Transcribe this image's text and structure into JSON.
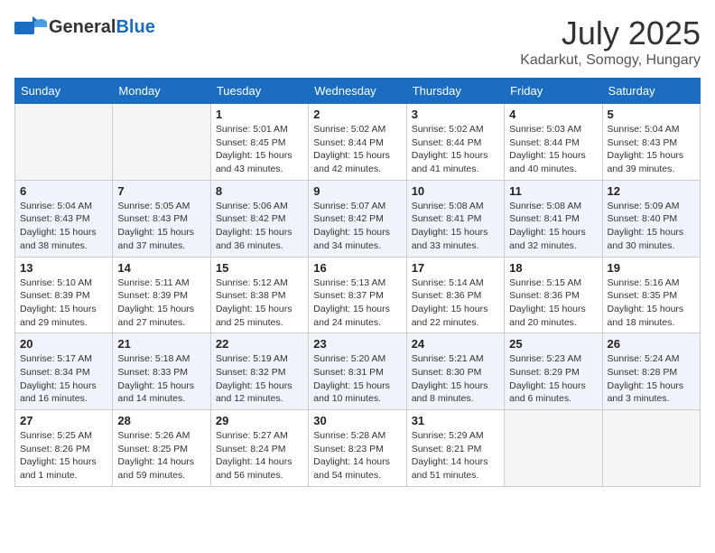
{
  "header": {
    "logo_general": "General",
    "logo_blue": "Blue",
    "month": "July 2025",
    "location": "Kadarkut, Somogy, Hungary"
  },
  "days_of_week": [
    "Sunday",
    "Monday",
    "Tuesday",
    "Wednesday",
    "Thursday",
    "Friday",
    "Saturday"
  ],
  "weeks": [
    [
      {
        "day": "",
        "info": ""
      },
      {
        "day": "",
        "info": ""
      },
      {
        "day": "1",
        "info": "Sunrise: 5:01 AM\nSunset: 8:45 PM\nDaylight: 15 hours and 43 minutes."
      },
      {
        "day": "2",
        "info": "Sunrise: 5:02 AM\nSunset: 8:44 PM\nDaylight: 15 hours and 42 minutes."
      },
      {
        "day": "3",
        "info": "Sunrise: 5:02 AM\nSunset: 8:44 PM\nDaylight: 15 hours and 41 minutes."
      },
      {
        "day": "4",
        "info": "Sunrise: 5:03 AM\nSunset: 8:44 PM\nDaylight: 15 hours and 40 minutes."
      },
      {
        "day": "5",
        "info": "Sunrise: 5:04 AM\nSunset: 8:43 PM\nDaylight: 15 hours and 39 minutes."
      }
    ],
    [
      {
        "day": "6",
        "info": "Sunrise: 5:04 AM\nSunset: 8:43 PM\nDaylight: 15 hours and 38 minutes."
      },
      {
        "day": "7",
        "info": "Sunrise: 5:05 AM\nSunset: 8:43 PM\nDaylight: 15 hours and 37 minutes."
      },
      {
        "day": "8",
        "info": "Sunrise: 5:06 AM\nSunset: 8:42 PM\nDaylight: 15 hours and 36 minutes."
      },
      {
        "day": "9",
        "info": "Sunrise: 5:07 AM\nSunset: 8:42 PM\nDaylight: 15 hours and 34 minutes."
      },
      {
        "day": "10",
        "info": "Sunrise: 5:08 AM\nSunset: 8:41 PM\nDaylight: 15 hours and 33 minutes."
      },
      {
        "day": "11",
        "info": "Sunrise: 5:08 AM\nSunset: 8:41 PM\nDaylight: 15 hours and 32 minutes."
      },
      {
        "day": "12",
        "info": "Sunrise: 5:09 AM\nSunset: 8:40 PM\nDaylight: 15 hours and 30 minutes."
      }
    ],
    [
      {
        "day": "13",
        "info": "Sunrise: 5:10 AM\nSunset: 8:39 PM\nDaylight: 15 hours and 29 minutes."
      },
      {
        "day": "14",
        "info": "Sunrise: 5:11 AM\nSunset: 8:39 PM\nDaylight: 15 hours and 27 minutes."
      },
      {
        "day": "15",
        "info": "Sunrise: 5:12 AM\nSunset: 8:38 PM\nDaylight: 15 hours and 25 minutes."
      },
      {
        "day": "16",
        "info": "Sunrise: 5:13 AM\nSunset: 8:37 PM\nDaylight: 15 hours and 24 minutes."
      },
      {
        "day": "17",
        "info": "Sunrise: 5:14 AM\nSunset: 8:36 PM\nDaylight: 15 hours and 22 minutes."
      },
      {
        "day": "18",
        "info": "Sunrise: 5:15 AM\nSunset: 8:36 PM\nDaylight: 15 hours and 20 minutes."
      },
      {
        "day": "19",
        "info": "Sunrise: 5:16 AM\nSunset: 8:35 PM\nDaylight: 15 hours and 18 minutes."
      }
    ],
    [
      {
        "day": "20",
        "info": "Sunrise: 5:17 AM\nSunset: 8:34 PM\nDaylight: 15 hours and 16 minutes."
      },
      {
        "day": "21",
        "info": "Sunrise: 5:18 AM\nSunset: 8:33 PM\nDaylight: 15 hours and 14 minutes."
      },
      {
        "day": "22",
        "info": "Sunrise: 5:19 AM\nSunset: 8:32 PM\nDaylight: 15 hours and 12 minutes."
      },
      {
        "day": "23",
        "info": "Sunrise: 5:20 AM\nSunset: 8:31 PM\nDaylight: 15 hours and 10 minutes."
      },
      {
        "day": "24",
        "info": "Sunrise: 5:21 AM\nSunset: 8:30 PM\nDaylight: 15 hours and 8 minutes."
      },
      {
        "day": "25",
        "info": "Sunrise: 5:23 AM\nSunset: 8:29 PM\nDaylight: 15 hours and 6 minutes."
      },
      {
        "day": "26",
        "info": "Sunrise: 5:24 AM\nSunset: 8:28 PM\nDaylight: 15 hours and 3 minutes."
      }
    ],
    [
      {
        "day": "27",
        "info": "Sunrise: 5:25 AM\nSunset: 8:26 PM\nDaylight: 15 hours and 1 minute."
      },
      {
        "day": "28",
        "info": "Sunrise: 5:26 AM\nSunset: 8:25 PM\nDaylight: 14 hours and 59 minutes."
      },
      {
        "day": "29",
        "info": "Sunrise: 5:27 AM\nSunset: 8:24 PM\nDaylight: 14 hours and 56 minutes."
      },
      {
        "day": "30",
        "info": "Sunrise: 5:28 AM\nSunset: 8:23 PM\nDaylight: 14 hours and 54 minutes."
      },
      {
        "day": "31",
        "info": "Sunrise: 5:29 AM\nSunset: 8:21 PM\nDaylight: 14 hours and 51 minutes."
      },
      {
        "day": "",
        "info": ""
      },
      {
        "day": "",
        "info": ""
      }
    ]
  ]
}
